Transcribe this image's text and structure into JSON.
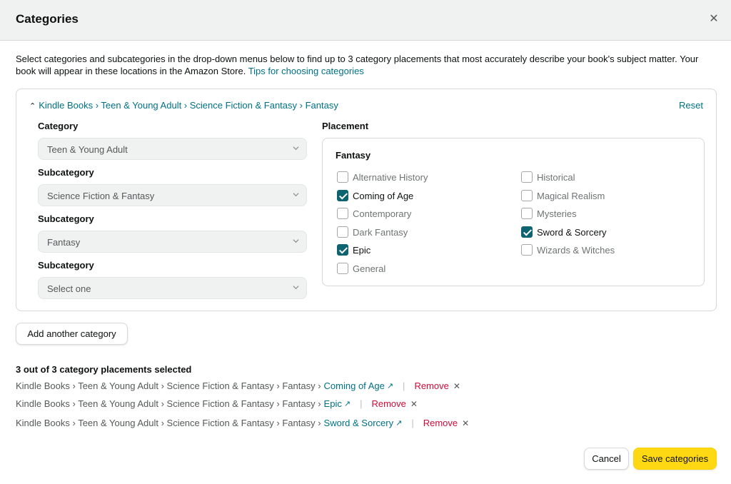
{
  "dialog": {
    "title": "Categories",
    "close_icon": "close-icon",
    "intro_text": "Select categories and subcategories in the drop-down menus below to find up to 3 category placements that most accurately describe your book's subject matter. Your book will appear in these locations in the Amazon Store.",
    "tips_link": "Tips for choosing categories"
  },
  "panel": {
    "breadcrumb": "Kindle Books › Teen & Young Adult › Science Fiction & Fantasy › Fantasy",
    "reset_label": "Reset",
    "category_label": "Category",
    "category_value": "Teen & Young Adult",
    "subcategory_label": "Subcategory",
    "sub1_value": "Science Fiction & Fantasy",
    "sub2_value": "Fantasy",
    "sub3_value": "Select one",
    "placement_label": "Placement",
    "placement_group": "Fantasy",
    "options": [
      {
        "label": "Alternative History",
        "checked": false
      },
      {
        "label": "Coming of Age",
        "checked": true
      },
      {
        "label": "Contemporary",
        "checked": false
      },
      {
        "label": "Dark Fantasy",
        "checked": false
      },
      {
        "label": "Epic",
        "checked": true
      },
      {
        "label": "General",
        "checked": false
      },
      {
        "label": "Historical",
        "checked": false
      },
      {
        "label": "Magical Realism",
        "checked": false
      },
      {
        "label": "Mysteries",
        "checked": false
      },
      {
        "label": "Sword & Sorcery",
        "checked": true
      },
      {
        "label": "Wizards & Witches",
        "checked": false
      }
    ]
  },
  "add_button": "Add another category",
  "selected": {
    "count_text": "3 out of 3 category placements selected",
    "path": "Kindle Books › Teen & Young Adult › Science Fiction & Fantasy › Fantasy ›",
    "remove_label": "Remove",
    "separator": "|",
    "items": [
      "Coming of Age",
      "Epic",
      "Sword & Sorcery"
    ]
  },
  "footer": {
    "cancel_label": "Cancel",
    "save_label": "Save categories"
  },
  "colors": {
    "link": "#007185",
    "checkbox": "#0d6370",
    "primary_button": "#ffd814",
    "remove": "#cc0c39"
  }
}
